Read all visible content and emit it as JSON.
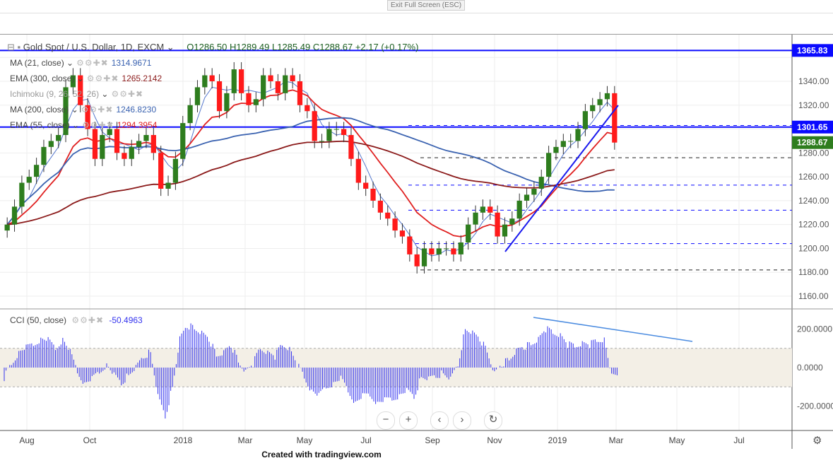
{
  "window": {
    "exit_fullscreen": "Exit Full Screen (ESC)",
    "footer": "Created with tradingview.com"
  },
  "header": {
    "symbol": "Gold Spot / U.S. Dollar, 1D, EXCM",
    "ohlc": "O1286.50  H1289.49  L1285.49  C1288.67  +2.17 (+0.17%)"
  },
  "indicators": [
    {
      "label": "MA (21, close)",
      "value": "1314.9671",
      "color": "#3a62b0"
    },
    {
      "label": "EMA (300, close)",
      "value": "1265.2142",
      "color": "#8b1a1a"
    },
    {
      "label": "Ichimoku (9, 26, 52, 26)",
      "value": "",
      "color": "#888888"
    },
    {
      "label": "MA (200, close)",
      "value": "1246.8230",
      "color": "#3a62b0"
    },
    {
      "label": "EMA (55, close)",
      "value": "1294.3954",
      "color": "#e02020"
    }
  ],
  "cci": {
    "label": "CCI (50, close)",
    "value": "-50.4963",
    "color": "#3333ee"
  },
  "price_badges": [
    {
      "text": "1365.83",
      "value": 1365.83,
      "color": "#0a0aff"
    },
    {
      "text": "1301.65",
      "value": 1301.65,
      "color": "#0a0aff"
    },
    {
      "text": "1288.67",
      "value": 1288.67,
      "color": "#2e7d1e"
    }
  ],
  "chart_data": {
    "type": "candlestick",
    "y_ticks": [
      "1340.00",
      "1320.00",
      "1300.00",
      "1280.00",
      "1260.00",
      "1240.00",
      "1220.00",
      "1200.00",
      "1180.00",
      "1160.00"
    ],
    "ylim": [
      1150,
      1372
    ],
    "x_ticks": [
      "Aug",
      "Oct",
      "2018",
      "Mar",
      "May",
      "Jul",
      "Sep",
      "Nov",
      "2019",
      "Mar",
      "May",
      "Jul"
    ],
    "closes": [
      1220,
      1235,
      1255,
      1260,
      1270,
      1285,
      1290,
      1295,
      1335,
      1345,
      1320,
      1300,
      1275,
      1295,
      1300,
      1280,
      1275,
      1285,
      1290,
      1295,
      1280,
      1250,
      1255,
      1275,
      1305,
      1320,
      1335,
      1345,
      1340,
      1315,
      1330,
      1350,
      1330,
      1320,
      1325,
      1345,
      1340,
      1330,
      1345,
      1340,
      1320,
      1315,
      1290,
      1290,
      1300,
      1300,
      1295,
      1275,
      1255,
      1250,
      1240,
      1230,
      1225,
      1215,
      1210,
      1195,
      1185,
      1200,
      1195,
      1200,
      1200,
      1195,
      1205,
      1220,
      1230,
      1235,
      1230,
      1210,
      1220,
      1225,
      1240,
      1245,
      1250,
      1260,
      1280,
      1285,
      1290,
      1290,
      1300,
      1315,
      1320,
      1325,
      1330,
      1288.67
    ],
    "horizontal_levels": [
      {
        "value": 1365.83,
        "style": "solid"
      },
      {
        "value": 1301.65,
        "style": "solid"
      },
      {
        "value": 1303,
        "style": "dashed"
      },
      {
        "value": 1276,
        "style": "dashed-black"
      },
      {
        "value": 1253,
        "style": "dashed"
      },
      {
        "value": 1232,
        "style": "dashed"
      },
      {
        "value": 1204,
        "style": "dashed"
      },
      {
        "value": 1182,
        "style": "dashed-black"
      }
    ],
    "cci_ticks": [
      "200.0000",
      "0.0000",
      "-200.0000"
    ],
    "cci_values": [
      -50,
      20,
      80,
      100,
      120,
      150,
      140,
      100,
      150,
      80,
      -20,
      -80,
      -60,
      -20,
      20,
      -40,
      -80,
      -40,
      0,
      60,
      80,
      -150,
      -250,
      -100,
      150,
      220,
      200,
      180,
      150,
      60,
      80,
      120,
      30,
      -20,
      20,
      100,
      80,
      60,
      120,
      100,
      20,
      -50,
      -120,
      -150,
      -100,
      -80,
      -60,
      -120,
      -180,
      -150,
      -140,
      -180,
      -170,
      -160,
      -140,
      -120,
      -150,
      -50,
      -60,
      -40,
      -30,
      -60,
      20,
      200,
      180,
      150,
      80,
      -30,
      20,
      40,
      90,
      110,
      120,
      150,
      200,
      180,
      170,
      120,
      110,
      130,
      120,
      140,
      150,
      -50
    ],
    "cci_band": [
      -100,
      100
    ]
  }
}
